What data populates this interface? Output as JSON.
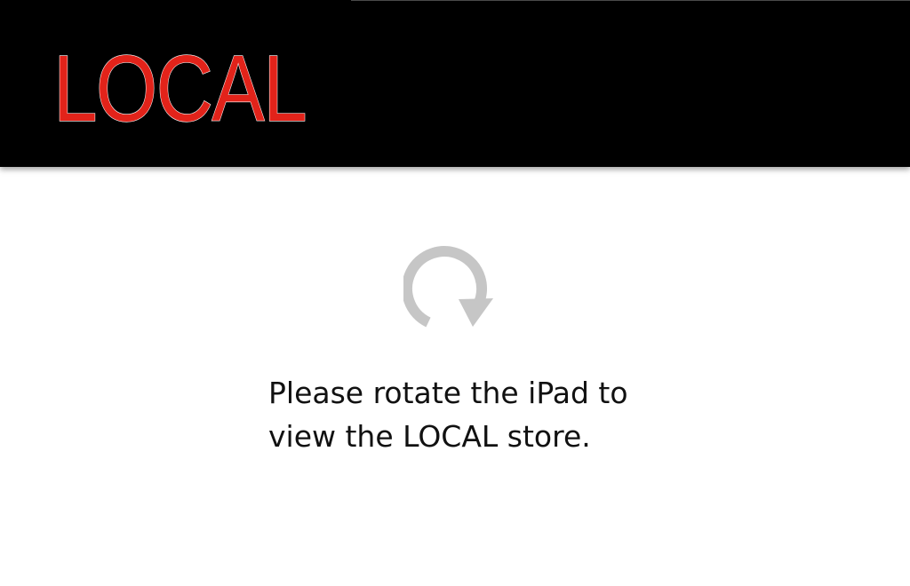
{
  "header": {
    "logo_text": "LOCAL",
    "logo_color": "#e2231a",
    "background_color": "#000000"
  },
  "main": {
    "icon": "rotate-device-icon",
    "icon_color": "#c6c6c6",
    "message_line1": "Please rotate the iPad to",
    "message_line2": "view the LOCAL store."
  }
}
